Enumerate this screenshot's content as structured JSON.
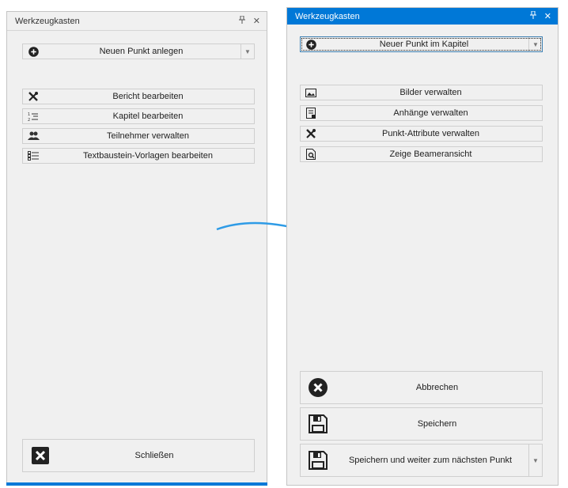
{
  "left_panel": {
    "title": "Werkzeugkasten",
    "pin_glyph": "⊕",
    "close_glyph": "✕",
    "new_point": {
      "label": "Neuen Punkt anlegen",
      "icon": "plus-circle-icon"
    },
    "items": [
      {
        "label": "Bericht bearbeiten",
        "icon": "tools-icon"
      },
      {
        "label": "Kapitel bearbeiten",
        "icon": "list-numbered-icon"
      },
      {
        "label": "Teilnehmer verwalten",
        "icon": "users-icon"
      },
      {
        "label": "Textbaustein-Vorlagen bearbeiten",
        "icon": "list-details-icon"
      }
    ],
    "close_button": {
      "label": "Schließen",
      "icon": "close-box-icon"
    }
  },
  "right_panel": {
    "title": "Werkzeugkasten",
    "pin_glyph": "⊕",
    "close_glyph": "✕",
    "new_point": {
      "label": "Neuer Punkt im Kapitel",
      "icon": "plus-circle-icon"
    },
    "items": [
      {
        "label": "Bilder verwalten",
        "icon": "image-icon"
      },
      {
        "label": "Anhänge verwalten",
        "icon": "attachment-icon"
      },
      {
        "label": "Punkt-Attribute verwalten",
        "icon": "tools-icon"
      },
      {
        "label": "Zeige Beameransicht",
        "icon": "preview-icon"
      }
    ],
    "actions": [
      {
        "label": "Abbrechen",
        "icon": "cancel-circle-icon"
      },
      {
        "label": "Speichern",
        "icon": "save-icon"
      },
      {
        "label": "Speichern und weiter zum nächsten Punkt",
        "icon": "save-icon"
      }
    ]
  },
  "colors": {
    "accent": "#0078d7",
    "arrow": "#2e9be6"
  }
}
